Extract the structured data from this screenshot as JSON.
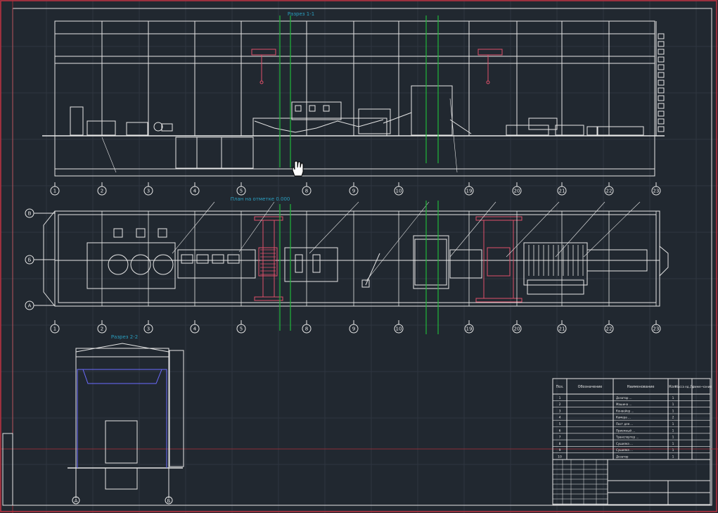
{
  "sections": {
    "section_1_1": "Разрез 1-1",
    "plan": "План на отметке 0.000",
    "section_2_2": "Разрез 2-2"
  },
  "axes": {
    "columns": [
      "1",
      "2",
      "3",
      "4",
      "5",
      "8",
      "9",
      "10",
      "19",
      "20",
      "21",
      "22",
      "23"
    ],
    "rows": [
      "В",
      "Б",
      "А"
    ],
    "section_rows": [
      "А",
      "Б"
    ]
  },
  "spec_table": {
    "headers": [
      "Поз.",
      "Обозначение",
      "Наименование",
      "Кол.",
      "Масса ед., кг",
      "Приме-чание"
    ],
    "rows": [
      {
        "pos": "1",
        "name": "Дозатор ...",
        "qty": "1"
      },
      {
        "pos": "2",
        "name": "Машина ...",
        "qty": "1"
      },
      {
        "pos": "3",
        "name": "Конвейер ...",
        "qty": "1"
      },
      {
        "pos": "4",
        "name": "Камера ...",
        "qty": "2"
      },
      {
        "pos": "5",
        "name": "Пост для ...",
        "qty": "1"
      },
      {
        "pos": "6",
        "name": "Приемный ...",
        "qty": "1"
      },
      {
        "pos": "7",
        "name": "Транспортер ...",
        "qty": "1"
      },
      {
        "pos": "8",
        "name": "Сушилка ...",
        "qty": "1"
      },
      {
        "pos": "9",
        "name": "Сушилка ...",
        "qty": "1"
      },
      {
        "pos": "10",
        "name": "Дозатор",
        "qty": "1"
      }
    ]
  },
  "colors": {
    "background": "#212830",
    "line": "#e6e6e6",
    "break_line": "#1fb83a",
    "crane": "#e0506a",
    "title_text": "#2a9fc0",
    "crosshair": "#b0303a",
    "section_blue": "#6c6cff"
  },
  "cursor_icon": "hand-cursor-icon"
}
